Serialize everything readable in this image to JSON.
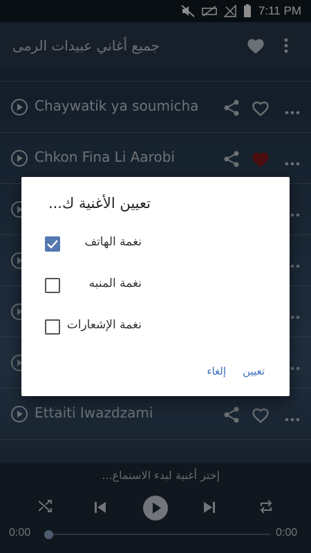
{
  "status_bar": {
    "time": "7:11 PM"
  },
  "app_bar": {
    "title": "جميع أغاني عبيدات الرمى"
  },
  "songs": [
    {
      "title": "Chaywatik ya soumicha",
      "favorite": false
    },
    {
      "title": "Chkon Fina Li Aarobi",
      "favorite": true
    },
    {
      "title": "",
      "favorite": false
    },
    {
      "title": "",
      "favorite": false
    },
    {
      "title": "",
      "favorite": false
    },
    {
      "title": "",
      "favorite": false
    },
    {
      "title": "Ettaiti Iwazdzami",
      "favorite": false
    }
  ],
  "dialog": {
    "title": "تعيين الأغنية ك...",
    "options": [
      {
        "label": "نغمة الهاتف",
        "checked": true
      },
      {
        "label": "نغمة المنبه",
        "checked": false
      },
      {
        "label": "نغمة الإشعارات",
        "checked": false
      }
    ],
    "cancel_label": "إلغاء",
    "confirm_label": "تعيين"
  },
  "player": {
    "now_playing": "إختر أغنية لبدء الاستماع...",
    "current_time": "0:00",
    "total_time": "0:00",
    "progress": 0
  },
  "colors": {
    "accent": "#5577b0",
    "favorite": "#8b1a1a",
    "button_text": "#3a6fc0"
  }
}
